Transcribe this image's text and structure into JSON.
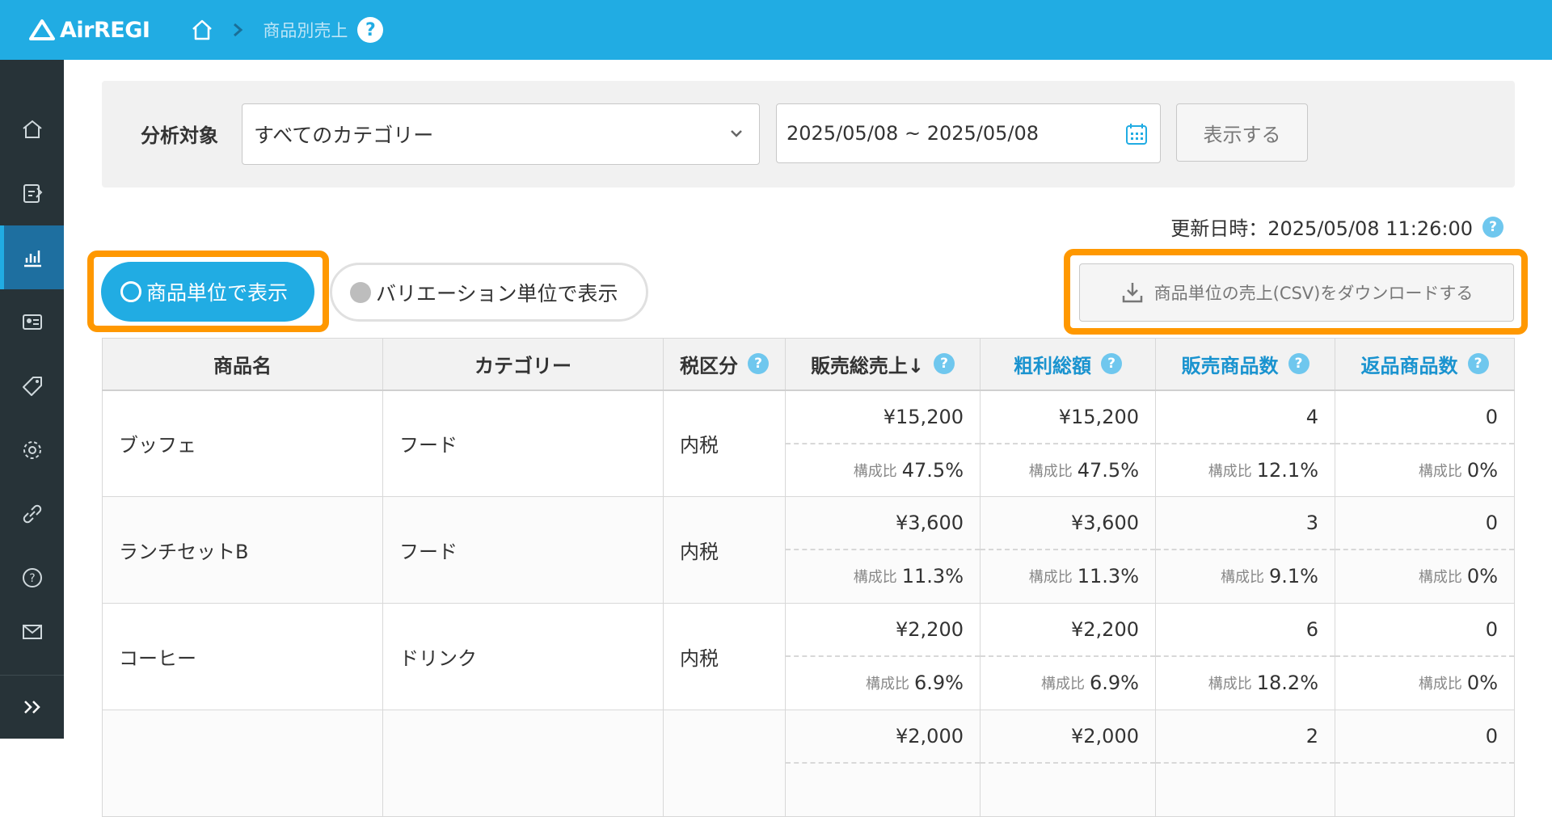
{
  "header": {
    "logo_text": "AirREGI",
    "breadcrumb": "商品別売上",
    "help_glyph": "?"
  },
  "filters": {
    "label": "分析対象",
    "category_value": "すべてのカテゴリー",
    "date_range": "2025/05/08 ~ 2025/05/08",
    "show_button": "表示する"
  },
  "updated": {
    "text": "更新日時：2025/05/08 11:26:00"
  },
  "view_toggle": {
    "product": "商品単位で表示",
    "variation": "バリエーション単位で表示"
  },
  "download_button": "商品単位の売上(CSV)をダウンロードする",
  "table": {
    "headers": {
      "name": "商品名",
      "category": "カテゴリー",
      "tax": "税区分",
      "sales": "販売総売上↓",
      "profit": "粗利総額",
      "sold": "販売商品数",
      "returned": "返品商品数"
    },
    "ratio_label": "構成比",
    "rows": [
      {
        "name": "ブッフェ",
        "category": "フード",
        "tax": "内税",
        "sales": "¥15,200",
        "sales_ratio": "47.5%",
        "profit": "¥15,200",
        "profit_ratio": "47.5%",
        "sold": "4",
        "sold_ratio": "12.1%",
        "returned": "0",
        "returned_ratio": "0%"
      },
      {
        "name": "ランチセットB",
        "category": "フード",
        "tax": "内税",
        "sales": "¥3,600",
        "sales_ratio": "11.3%",
        "profit": "¥3,600",
        "profit_ratio": "11.3%",
        "sold": "3",
        "sold_ratio": "9.1%",
        "returned": "0",
        "returned_ratio": "0%"
      },
      {
        "name": "コーヒー",
        "category": "ドリンク",
        "tax": "内税",
        "sales": "¥2,200",
        "sales_ratio": "6.9%",
        "profit": "¥2,200",
        "profit_ratio": "6.9%",
        "sold": "6",
        "sold_ratio": "18.2%",
        "returned": "0",
        "returned_ratio": "0%"
      },
      {
        "name": "",
        "category": "",
        "tax": "",
        "sales": "¥2,000",
        "sales_ratio": "",
        "profit": "¥2,000",
        "profit_ratio": "",
        "sold": "2",
        "sold_ratio": "",
        "returned": "0",
        "returned_ratio": ""
      }
    ]
  },
  "colors": {
    "header_bg": "#21ace3",
    "sidebar_bg": "#273338",
    "highlight": "#ff9800",
    "link_blue": "#1a93cf"
  }
}
